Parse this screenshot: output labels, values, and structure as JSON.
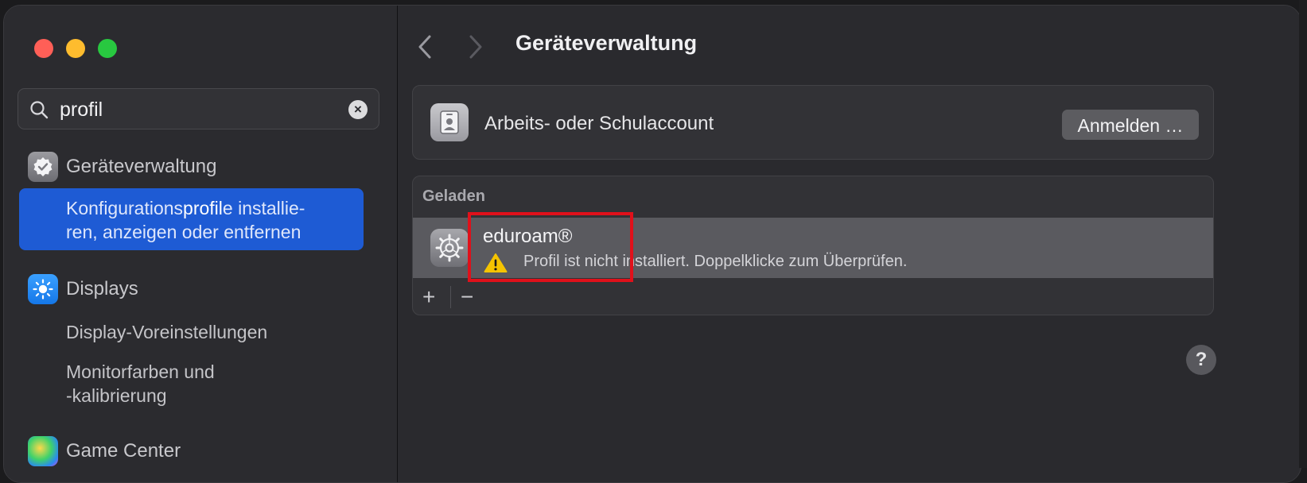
{
  "window": {
    "traffic_lights": {
      "close": "#ff5f57",
      "minimize": "#febc2e",
      "maximize": "#28c840"
    }
  },
  "sidebar": {
    "search": {
      "value": "profil",
      "icon": "magnifier-icon",
      "clear_icon": "clear-icon"
    },
    "sections": [
      {
        "label": "Geräteverwaltung",
        "icon": "checkmark-seal-icon",
        "items": [
          {
            "pre": "Konfigurations",
            "highlight": "profil",
            "post": "e installie-",
            "line2": "ren, anzeigen oder entfernen",
            "selected": true
          }
        ]
      },
      {
        "label": "Displays",
        "icon": "sun-icon",
        "items": [
          {
            "label": "Display-Voreinstellungen"
          },
          {
            "line1": "Monitorfarben und",
            "line2": "-kalibrierung"
          }
        ]
      },
      {
        "label": "Game Center",
        "icon": "game-center-icon"
      }
    ]
  },
  "main": {
    "title": "Geräteverwaltung",
    "back_icon": "chevron-left-icon",
    "forward_icon": "chevron-right-icon",
    "account": {
      "label": "Arbeits- oder Schulaccount",
      "button": "Anmelden …",
      "icon": "id-badge-icon"
    },
    "loaded": {
      "header": "Geladen",
      "profiles": [
        {
          "name": "eduroam®",
          "status": "Profil ist nicht installiert. Doppelklicke zum Überprüfen.",
          "icon": "gear-icon",
          "warning_icon": "warning-triangle-icon"
        }
      ],
      "add": "+",
      "remove": "−"
    },
    "help": "?"
  },
  "colors": {
    "accent": "#1e5bd4",
    "highlight_box": "#e0101a",
    "warning": "#f5c400"
  }
}
